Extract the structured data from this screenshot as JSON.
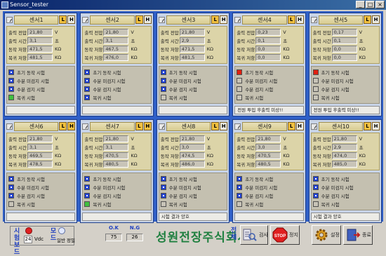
{
  "window": {
    "title": "Sensor_tester",
    "min": "_",
    "max": "□",
    "close": "×"
  },
  "panels": [
    {
      "name": "센서1",
      "h_on": false,
      "vals": [
        "21,80",
        "3,1",
        "471,5",
        "481,5"
      ],
      "tests": [
        "blue",
        "blue",
        "blue",
        "green"
      ],
      "msg": ""
    },
    {
      "name": "센서2",
      "h_on": false,
      "vals": [
        "21,80",
        "3,1",
        "467,5",
        "476,0"
      ],
      "tests": [
        "blue",
        "blue",
        "blue",
        "blue"
      ],
      "msg": ""
    },
    {
      "name": "센서3",
      "h_on": false,
      "vals": [
        "21,80",
        "2,9",
        "471,5",
        "481,5"
      ],
      "tests": [
        "blue",
        "blue",
        "blue",
        "none"
      ],
      "msg": ""
    },
    {
      "name": "센서4",
      "h_on": false,
      "vals": [
        "0,23",
        "0,1",
        "0,0",
        "0,0"
      ],
      "tests": [
        "red",
        "none",
        "none",
        "none"
      ],
      "msg": "전원 투입 후출력 미상!!"
    },
    {
      "name": "센서5",
      "h_on": false,
      "vals": [
        "0,17",
        "0,1",
        "0,0",
        "0,0"
      ],
      "tests": [
        "red",
        "none",
        "none",
        "none"
      ],
      "msg": "전원 투입 후출력 미상!!"
    },
    {
      "name": "센서6",
      "h_on": true,
      "vals": [
        "21,80",
        "3,1",
        "469,5",
        "478,5"
      ],
      "tests": [
        "blue",
        "blue",
        "blue",
        "none"
      ],
      "msg": ""
    },
    {
      "name": "센서7",
      "h_on": true,
      "vals": [
        "21,80",
        "3,1",
        "470,5",
        "480,5"
      ],
      "tests": [
        "blue",
        "blue",
        "blue",
        "green"
      ],
      "msg": ""
    },
    {
      "name": "센서8",
      "h_on": false,
      "vals": [
        "21,80",
        "3,0",
        "474,5",
        "486,0"
      ],
      "tests": [
        "blue",
        "blue",
        "blue",
        "none"
      ],
      "msg": "시험 결과 양호"
    },
    {
      "name": "센서9",
      "h_on": false,
      "vals": [
        "21,80",
        "3,0",
        "470,5",
        "480,5"
      ],
      "tests": [
        "blue",
        "blue",
        "blue",
        "none"
      ],
      "msg": ""
    },
    {
      "name": "센서10",
      "h_on": false,
      "vals": [
        "21,80",
        "2,9",
        "474,0",
        "485,0"
      ],
      "tests": [
        "blue",
        "blue",
        "blue",
        "none"
      ],
      "msg": "시험 결과 양호"
    }
  ],
  "labels": {
    "measure": [
      "출력 전압",
      "출력 시간",
      "동작 저항",
      "복귀 저항"
    ],
    "units": [
      "V",
      "초",
      "KΩ",
      "KΩ"
    ],
    "tests": [
      "초기 동작 시험",
      "수분 미검지 시험",
      "수분 검지 시험",
      "복귀 시험"
    ],
    "l": "L",
    "h": "H"
  },
  "bottom": {
    "test_board": "시험보드",
    "voltage": "24",
    "vdc": "Vdc",
    "mode": "모드",
    "normal": "일반",
    "precise": "정밀",
    "ok_label": "O.K",
    "ng_label": "N.G",
    "ok_count": "75",
    "ng_count": "26",
    "company": "성원전장주식회사",
    "all": "전체",
    "inspect": "검사",
    "stop": "정지",
    "setup": "설정",
    "exit": "종료"
  },
  "colors": {
    "title_bar": "#0a246a",
    "panel_frame": "#3060c8",
    "ok": "#2040d0",
    "fail": "#e02010",
    "restore": "#40c040"
  }
}
